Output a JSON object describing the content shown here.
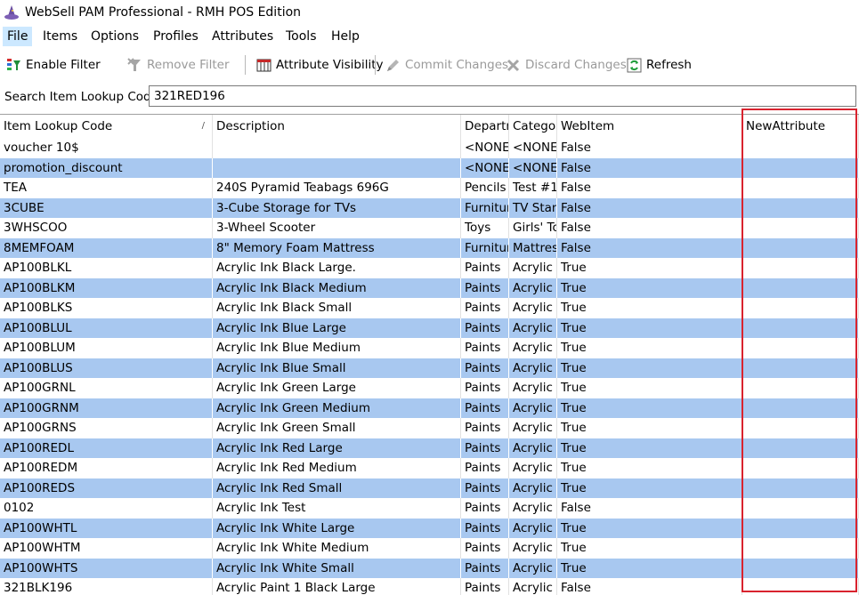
{
  "window": {
    "title": "WebSell PAM Professional - RMH POS Edition"
  },
  "menu": [
    {
      "label": "File",
      "active": true
    },
    {
      "label": "Items"
    },
    {
      "label": "Options"
    },
    {
      "label": "Profiles"
    },
    {
      "label": "Attributes"
    },
    {
      "label": "Tools"
    },
    {
      "label": "Help"
    }
  ],
  "toolbar": {
    "enable_filter": "Enable Filter",
    "remove_filter": "Remove Filter",
    "attribute_visibility": "Attribute Visibility",
    "commit_changes": "Commit Changes",
    "discard_changes": "Discard Changes",
    "refresh": "Refresh"
  },
  "search": {
    "label": "Search Item Lookup Code:",
    "value": "321RED196"
  },
  "grid": {
    "columns": [
      "Item Lookup Code",
      "Description",
      "Department",
      "Category",
      "WebItem",
      "NewAttribute"
    ],
    "rows": [
      [
        "voucher 10$",
        "",
        "<NONE>",
        "<NONE>",
        "False",
        ""
      ],
      [
        "promotion_discount",
        "",
        "<NONE>",
        "<NONE>",
        "False",
        ""
      ],
      [
        "TEA",
        "240S Pyramid Teabags 696G",
        "Pencils",
        "Test #1",
        "False",
        ""
      ],
      [
        "3CUBE",
        "3-Cube Storage for TVs",
        "Furniture",
        "TV Stands",
        "False",
        ""
      ],
      [
        "3WHSCOO",
        "3-Wheel Scooter",
        "Toys",
        "Girls' Toys",
        "False",
        ""
      ],
      [
        "8MEMFOAM",
        "8\" Memory Foam Mattress",
        "Furniture",
        "Mattress",
        "False",
        ""
      ],
      [
        "AP100BLKL",
        "Acrylic Ink Black Large.",
        "Paints",
        "Acrylic Paints",
        "True",
        ""
      ],
      [
        "AP100BLKM",
        "Acrylic Ink Black Medium",
        "Paints",
        "Acrylic Paints",
        "True",
        ""
      ],
      [
        "AP100BLKS",
        "Acrylic Ink Black Small",
        "Paints",
        "Acrylic Paints",
        "True",
        ""
      ],
      [
        "AP100BLUL",
        "Acrylic Ink Blue Large",
        "Paints",
        "Acrylic Paints",
        "True",
        ""
      ],
      [
        "AP100BLUM",
        "Acrylic Ink Blue Medium",
        "Paints",
        "Acrylic Paints",
        "True",
        ""
      ],
      [
        "AP100BLUS",
        "Acrylic Ink Blue Small",
        "Paints",
        "Acrylic Paints",
        "True",
        ""
      ],
      [
        "AP100GRNL",
        "Acrylic Ink Green Large",
        "Paints",
        "Acrylic Paints",
        "True",
        ""
      ],
      [
        "AP100GRNM",
        "Acrylic Ink Green Medium",
        "Paints",
        "Acrylic Paints",
        "True",
        ""
      ],
      [
        "AP100GRNS",
        "Acrylic Ink Green Small",
        "Paints",
        "Acrylic Paints",
        "True",
        ""
      ],
      [
        "AP100REDL",
        "Acrylic Ink Red Large",
        "Paints",
        "Acrylic Paints",
        "True",
        ""
      ],
      [
        "AP100REDM",
        "Acrylic Ink Red Medium",
        "Paints",
        "Acrylic Paints",
        "True",
        ""
      ],
      [
        "AP100REDS",
        "Acrylic Ink Red Small",
        "Paints",
        "Acrylic Paints",
        "True",
        ""
      ],
      [
        "0102",
        "Acrylic Ink Test",
        "Paints",
        "Acrylic Paints",
        "False",
        ""
      ],
      [
        "AP100WHTL",
        "Acrylic Ink White Large",
        "Paints",
        "Acrylic Paints",
        "True",
        ""
      ],
      [
        "AP100WHTM",
        "Acrylic Ink White Medium",
        "Paints",
        "Acrylic Paints",
        "True",
        ""
      ],
      [
        "AP100WHTS",
        "Acrylic Ink White Small",
        "Paints",
        "Acrylic Paints",
        "True",
        ""
      ],
      [
        "321BLK196",
        "Acrylic Paint 1 Black Large",
        "Paints",
        "Acrylic Paints",
        "False",
        ""
      ]
    ]
  },
  "colors": {
    "alt_row": "#a8c8f0",
    "highlight_border": "#d9232e",
    "menu_active": "#cce8ff"
  },
  "icons": {
    "app": "wizard-hat-icon",
    "enable_filter": "funnel-add-icon",
    "remove_filter": "funnel-remove-icon",
    "attribute_visibility": "column-grid-icon",
    "commit_changes": "pencil-commit-icon",
    "discard_changes": "x-discard-icon",
    "refresh": "refresh-icon"
  }
}
